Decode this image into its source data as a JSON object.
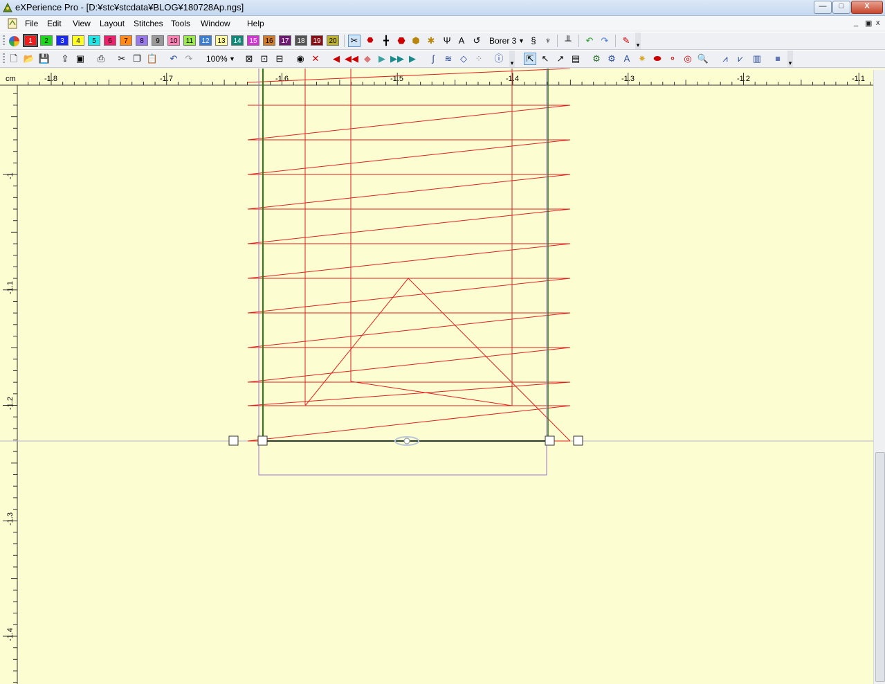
{
  "window": {
    "title": "eXPerience Pro - [D:¥stc¥stcdata¥BLOG¥180728Ap.ngs]",
    "minimize": "—",
    "maximize": "□",
    "close": "X"
  },
  "menu": {
    "items": [
      "File",
      "Edit",
      "View",
      "Layout",
      "Stitches",
      "Tools",
      "Window",
      "Help"
    ],
    "mdi_minimize": "_",
    "mdi_restore": "▣",
    "mdi_close": "x"
  },
  "toolbar1": {
    "swatches": [
      {
        "label": "1",
        "color": "#ee1c1c"
      },
      {
        "label": "2",
        "color": "#19d719"
      },
      {
        "label": "3",
        "color": "#1b2bee"
      },
      {
        "label": "4",
        "color": "#ffff20"
      },
      {
        "label": "5",
        "color": "#22e6e6"
      },
      {
        "label": "6",
        "color": "#ee1f6c"
      },
      {
        "label": "7",
        "color": "#ff8a1a"
      },
      {
        "label": "8",
        "color": "#9a78ee"
      },
      {
        "label": "9",
        "color": "#999999"
      },
      {
        "label": "10",
        "color": "#ff80b4"
      },
      {
        "label": "11",
        "color": "#9be84a"
      },
      {
        "label": "12",
        "color": "#3a7ed6"
      },
      {
        "label": "13",
        "color": "#fff6a0"
      },
      {
        "label": "14",
        "color": "#0f8a7a"
      },
      {
        "label": "15",
        "color": "#d334d6"
      },
      {
        "label": "16",
        "color": "#d07a2a"
      },
      {
        "label": "17",
        "color": "#6e1a72"
      },
      {
        "label": "18",
        "color": "#555555"
      },
      {
        "label": "19",
        "color": "#8a0f14"
      },
      {
        "label": "20",
        "color": "#bcb02a"
      }
    ],
    "needle_setting": "Borer 3"
  },
  "toolbar2": {
    "zoom": "100%"
  },
  "ruler": {
    "unit": "cm",
    "h_labels": [
      "-1.8",
      "-1.7",
      "-1.6",
      "-1.5",
      "-1.4",
      "-1.3",
      "-1.2",
      "-1.1"
    ],
    "v_labels": [
      "-1",
      "-1.1",
      "-1.2",
      "-1.3",
      "-1.4"
    ]
  },
  "colors": {
    "canvas": "#fcfdd0",
    "stitch": "#e02020",
    "guide": "#2a7a1a",
    "selection": "#9b74d9"
  }
}
